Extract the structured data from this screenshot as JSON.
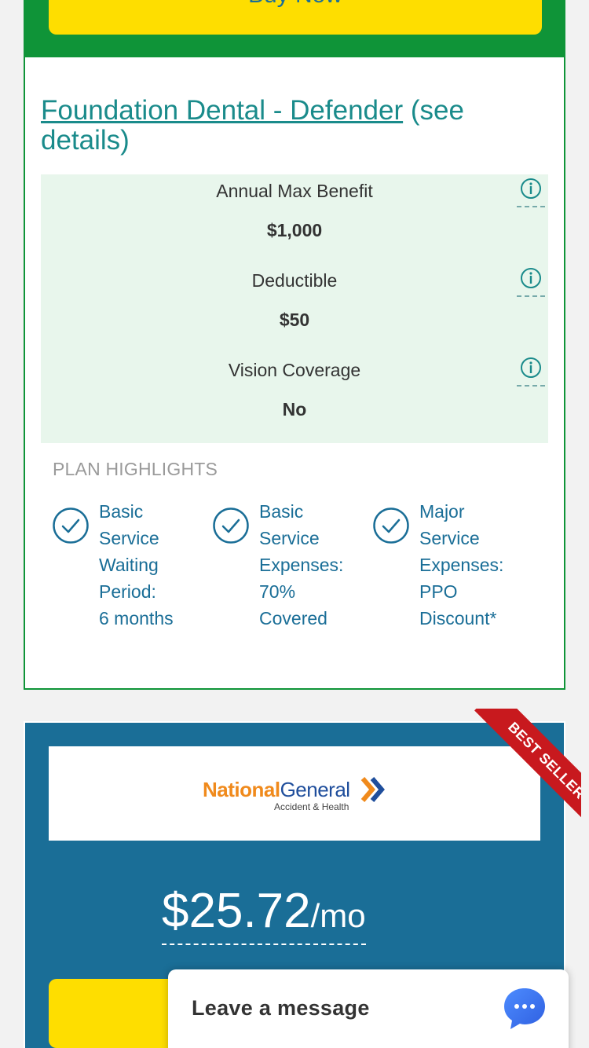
{
  "colors": {
    "brand_green": "#0f9438",
    "brand_blue": "#1a6e97",
    "button_yellow": "#fede00",
    "benefit_bg": "#e8f6ec",
    "link_teal": "#1a8b8b",
    "ribbon_red": "#c8191e"
  },
  "card1": {
    "buy_label": "Buy Now",
    "plan_name": "Foundation Dental - Defender",
    "plan_details": "(see details)",
    "benefits": [
      {
        "label": "Annual Max Benefit",
        "value": "$1,000",
        "icon": "info-icon"
      },
      {
        "label": "Deductible",
        "value": "$50",
        "icon": "info-icon"
      },
      {
        "label": "Vision Coverage",
        "value": "No",
        "icon": "info-icon"
      }
    ],
    "highlights_heading": "PLAN HIGHLIGHTS",
    "highlights": [
      {
        "lines": [
          "Basic",
          "Service",
          "Waiting",
          "Period:",
          "6 months"
        ],
        "icon": "check-circle-icon"
      },
      {
        "lines": [
          "Basic",
          "Service",
          "Expenses:",
          "70%",
          "Covered"
        ],
        "icon": "check-circle-icon"
      },
      {
        "lines": [
          "Major",
          "Service",
          "Expenses:",
          "PPO",
          "Discount*"
        ],
        "icon": "check-circle-icon"
      }
    ]
  },
  "card2": {
    "ribbon": "BEST SELLER",
    "logo_national": "National",
    "logo_general": "General",
    "logo_sub": "Accident & Health",
    "price": "$25.72",
    "per": "/mo"
  },
  "chat": {
    "label": "Leave a message",
    "icon": "chat-bubble-icon"
  }
}
